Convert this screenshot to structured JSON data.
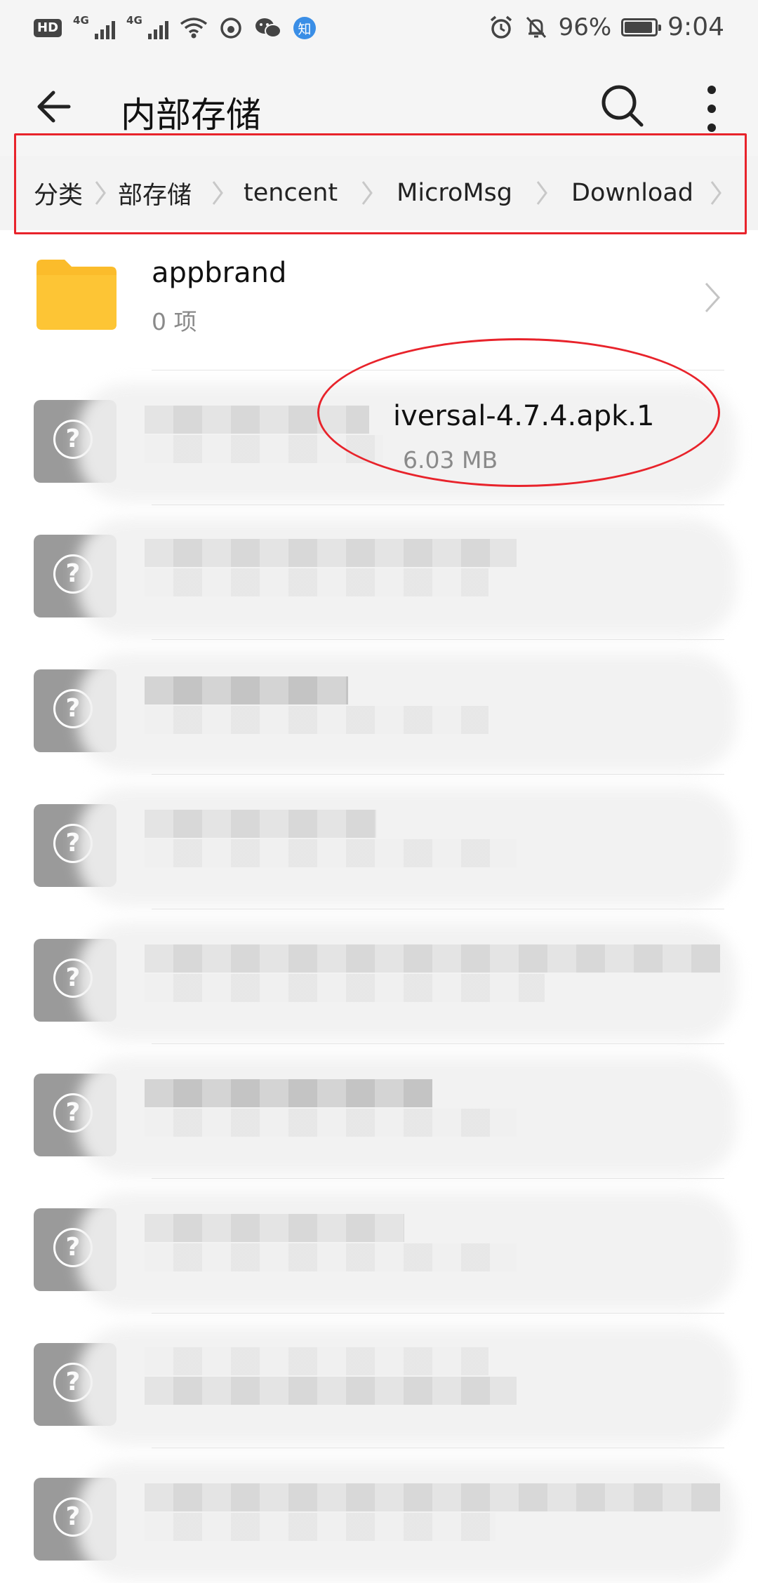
{
  "status_bar": {
    "hd": "HD",
    "net1": "4G",
    "net2": "4G",
    "zhihu_badge": "知",
    "battery_percent": "96%",
    "time": "9:04"
  },
  "app_bar": {
    "title": "内部存储"
  },
  "breadcrumb": {
    "items": [
      "分类",
      "部存储",
      "tencent",
      "MicroMsg",
      "Download"
    ]
  },
  "files": [
    {
      "name": "appbrand",
      "subtitle": "0 项",
      "type": "folder"
    },
    {
      "name": "iversal-4.7.4.apk.1",
      "subtitle": "6.03 MB",
      "type": "unknown",
      "partially_obscured": true
    },
    {
      "type": "unknown",
      "obscured": true
    },
    {
      "type": "unknown",
      "obscured": true
    },
    {
      "type": "unknown",
      "obscured": true
    },
    {
      "type": "unknown",
      "obscured": true
    },
    {
      "type": "unknown",
      "obscured": true
    },
    {
      "type": "unknown",
      "obscured": true
    },
    {
      "type": "unknown",
      "obscured": true
    },
    {
      "type": "unknown",
      "obscured": true
    }
  ],
  "colors": {
    "annotation": "#e8232b",
    "folder": "#fbbc2b",
    "file_icon": "#9a9a9a"
  }
}
